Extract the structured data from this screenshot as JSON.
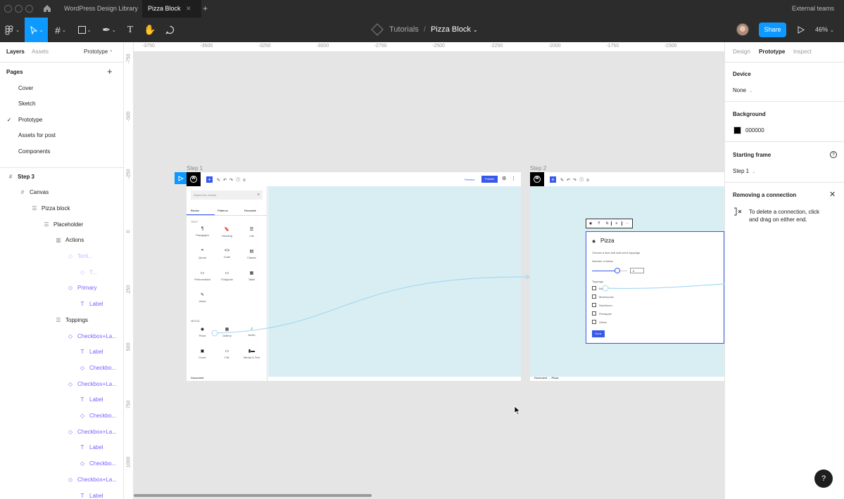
{
  "titlebar": {
    "tabs": [
      "WordPress Design Library",
      "Pizza Block"
    ],
    "active_tab": "Pizza Block",
    "external": "External teams"
  },
  "toolbar": {
    "breadcrumb_parent": "Tutorials",
    "breadcrumb_sep": "/",
    "file_name": "Pizza Block",
    "share_label": "Share",
    "zoom": "46%",
    "share_color": "#0d99ff"
  },
  "left_panel": {
    "tabs": [
      "Layers",
      "Assets",
      "Prototype"
    ],
    "pages_label": "Pages",
    "pages": [
      "Cover",
      "Sketch",
      "Prototype",
      "Assets for post",
      "Components"
    ],
    "selected_page": "Prototype",
    "layers": [
      {
        "label": "Step 3",
        "icon": "frame-icon"
      },
      {
        "label": "Canvas",
        "icon": "frame-icon"
      },
      {
        "label": "Pizza block",
        "icon": "autolayout-icon"
      },
      {
        "label": "Placeholder",
        "icon": "autolayout-icon"
      },
      {
        "label": "Actions",
        "icon": "columns-icon"
      },
      {
        "label": "Terti...",
        "icon": "instance-icon"
      },
      {
        "label": "T...",
        "icon": "instance-icon"
      },
      {
        "label": "Primary",
        "icon": "instance-icon"
      },
      {
        "label": "Label",
        "icon": "text-icon"
      },
      {
        "label": "Toppings",
        "icon": "autolayout-icon"
      },
      {
        "label": "Checkbox+La...",
        "icon": "instance-icon"
      },
      {
        "label": "Label",
        "icon": "text-icon"
      },
      {
        "label": "Checkbo...",
        "icon": "instance-icon"
      },
      {
        "label": "Checkbox+La...",
        "icon": "instance-icon"
      },
      {
        "label": "Label",
        "icon": "text-icon"
      },
      {
        "label": "Checkbo...",
        "icon": "instance-icon"
      },
      {
        "label": "Checkbox+La...",
        "icon": "instance-icon"
      },
      {
        "label": "Label",
        "icon": "text-icon"
      },
      {
        "label": "Checkbo...",
        "icon": "instance-icon"
      },
      {
        "label": "Checkbox+La...",
        "icon": "instance-icon"
      },
      {
        "label": "Label",
        "icon": "text-icon"
      }
    ]
  },
  "rulers": {
    "top": [
      "-3750",
      "-3500",
      "-3250",
      "-3000",
      "-2750",
      "-2500",
      "-2250",
      "-2000",
      "-1750",
      "-1500"
    ],
    "left": [
      "-750",
      "-500",
      "-250",
      "0",
      "250",
      "500",
      "750",
      "1000"
    ]
  },
  "canvas": {
    "frame1_label": "Step 1",
    "frame2_label": "Step 2",
    "wp1": {
      "preview": "Preview",
      "publish": "Publish",
      "search_placeholder": "Search for a block",
      "inserter_tabs": [
        "Blocks",
        "Patterns",
        "Reusable"
      ],
      "text_category": "TEXT",
      "blocks": [
        "Paragraph",
        "Heading",
        "List",
        "Quote",
        "Code",
        "Classic",
        "Preformatted",
        "Pullquote",
        "Table",
        "Verse"
      ],
      "media_category": "MEDIA",
      "media_blocks": [
        "Pizza",
        "Gallery",
        "Audio",
        "Cover",
        "File",
        "Media & Text"
      ],
      "footer": "Document"
    },
    "wp2": {
      "block_title": "Pizza",
      "description": "Choose a size and add some toppings.",
      "slices_label": "Number of slices",
      "slices_value": "8",
      "toppings_label": "Toppings",
      "toppings": [
        "Ba...",
        "Mushrooms",
        "Sweetcorn",
        "Pineapple",
        "Olives"
      ],
      "done_label": "Done",
      "footer": "Document → Pizza"
    },
    "wire_color": "#a5d8f5"
  },
  "right_panel": {
    "tabs": [
      "Design",
      "Prototype",
      "Inspect"
    ],
    "device_label": "Device",
    "device_value": "None",
    "background_label": "Background",
    "background_value": "000000",
    "background_color": "#000000",
    "starting_frame_label": "Starting frame",
    "starting_frame_value": "Step 1",
    "removing_title": "Removing a connection",
    "removing_text_1": "To delete a connection, click",
    "removing_text_2": "and drag on either end."
  },
  "help_label": "?"
}
